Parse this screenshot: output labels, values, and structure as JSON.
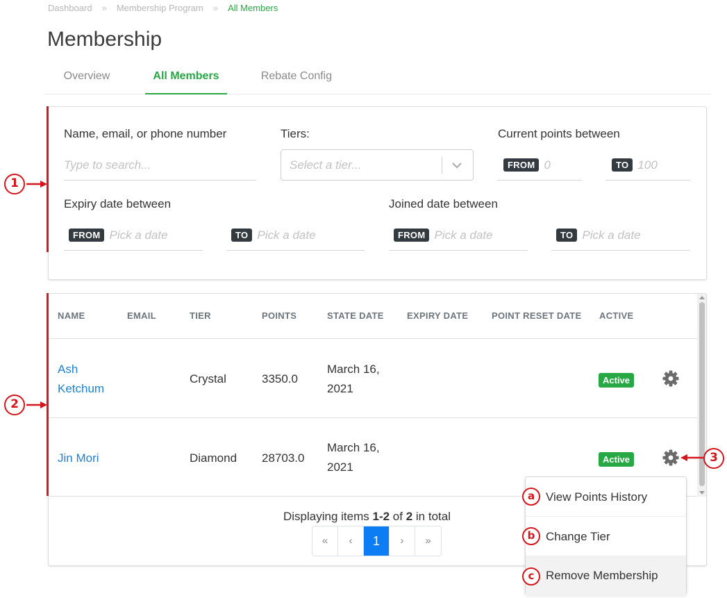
{
  "breadcrumb": [
    "Dashboard",
    "Membership Program",
    "All Members"
  ],
  "breadcrumb_sep": "»",
  "page_title": "Membership",
  "tabs": [
    {
      "label": "Overview",
      "active": false
    },
    {
      "label": "All Members",
      "active": true
    },
    {
      "label": "Rebate Config",
      "active": false
    }
  ],
  "filters": {
    "search_label": "Name, email, or phone number",
    "search_placeholder": "Type to search...",
    "tiers_label": "Tiers:",
    "tiers_placeholder": "Select a tier...",
    "points_label": "Current points between",
    "points_from_badge": "FROM",
    "points_from_placeholder": "0",
    "points_to_badge": "TO",
    "points_to_placeholder": "100",
    "expiry_label": "Expiry date between",
    "expiry_from_badge": "FROM",
    "expiry_from_placeholder": "Pick a date",
    "expiry_to_badge": "TO",
    "expiry_to_placeholder": "Pick a date",
    "joined_label": "Joined date between",
    "joined_from_badge": "FROM",
    "joined_from_placeholder": "Pick a date",
    "joined_to_badge": "TO",
    "joined_to_placeholder": "Pick a date"
  },
  "table": {
    "headers": [
      "NAME",
      "EMAIL",
      "TIER",
      "POINTS",
      "STATE DATE",
      "EXPIRY DATE",
      "POINT RESET DATE",
      "ACTIVE"
    ],
    "rows": [
      {
        "name_line1": "Ash",
        "name_line2": "Ketchum",
        "email": "",
        "tier": "Crystal",
        "points": "3350.0",
        "state_date_line1": "March 16,",
        "state_date_line2": "2021",
        "expiry_date": "",
        "reset_date": "",
        "status": "Active"
      },
      {
        "name_line1": "Jin Mori",
        "name_line2": "",
        "email": "",
        "tier": "Diamond",
        "points": "28703.0",
        "state_date_line1": "March 16,",
        "state_date_line2": "2021",
        "expiry_date": "",
        "reset_date": "",
        "status": "Active"
      }
    ]
  },
  "pagination": {
    "text_prefix": "Displaying items ",
    "range": "1-2",
    "text_mid": " of ",
    "total": "2",
    "text_suffix": " in total",
    "first": "«",
    "prev": "‹",
    "current_page": "1",
    "next": "›",
    "last": "»"
  },
  "dropdown_menu": {
    "items": [
      "View Points History",
      "Change Tier",
      "Remove Membership"
    ]
  },
  "annotations": {
    "callouts": [
      "1",
      "2",
      "3"
    ],
    "letters": [
      "a",
      "b",
      "c"
    ],
    "color": "#d5141b"
  },
  "colors": {
    "accent_green": "#28a745",
    "link_blue": "#1e7fd0",
    "page_active_blue": "#0d7df4"
  }
}
